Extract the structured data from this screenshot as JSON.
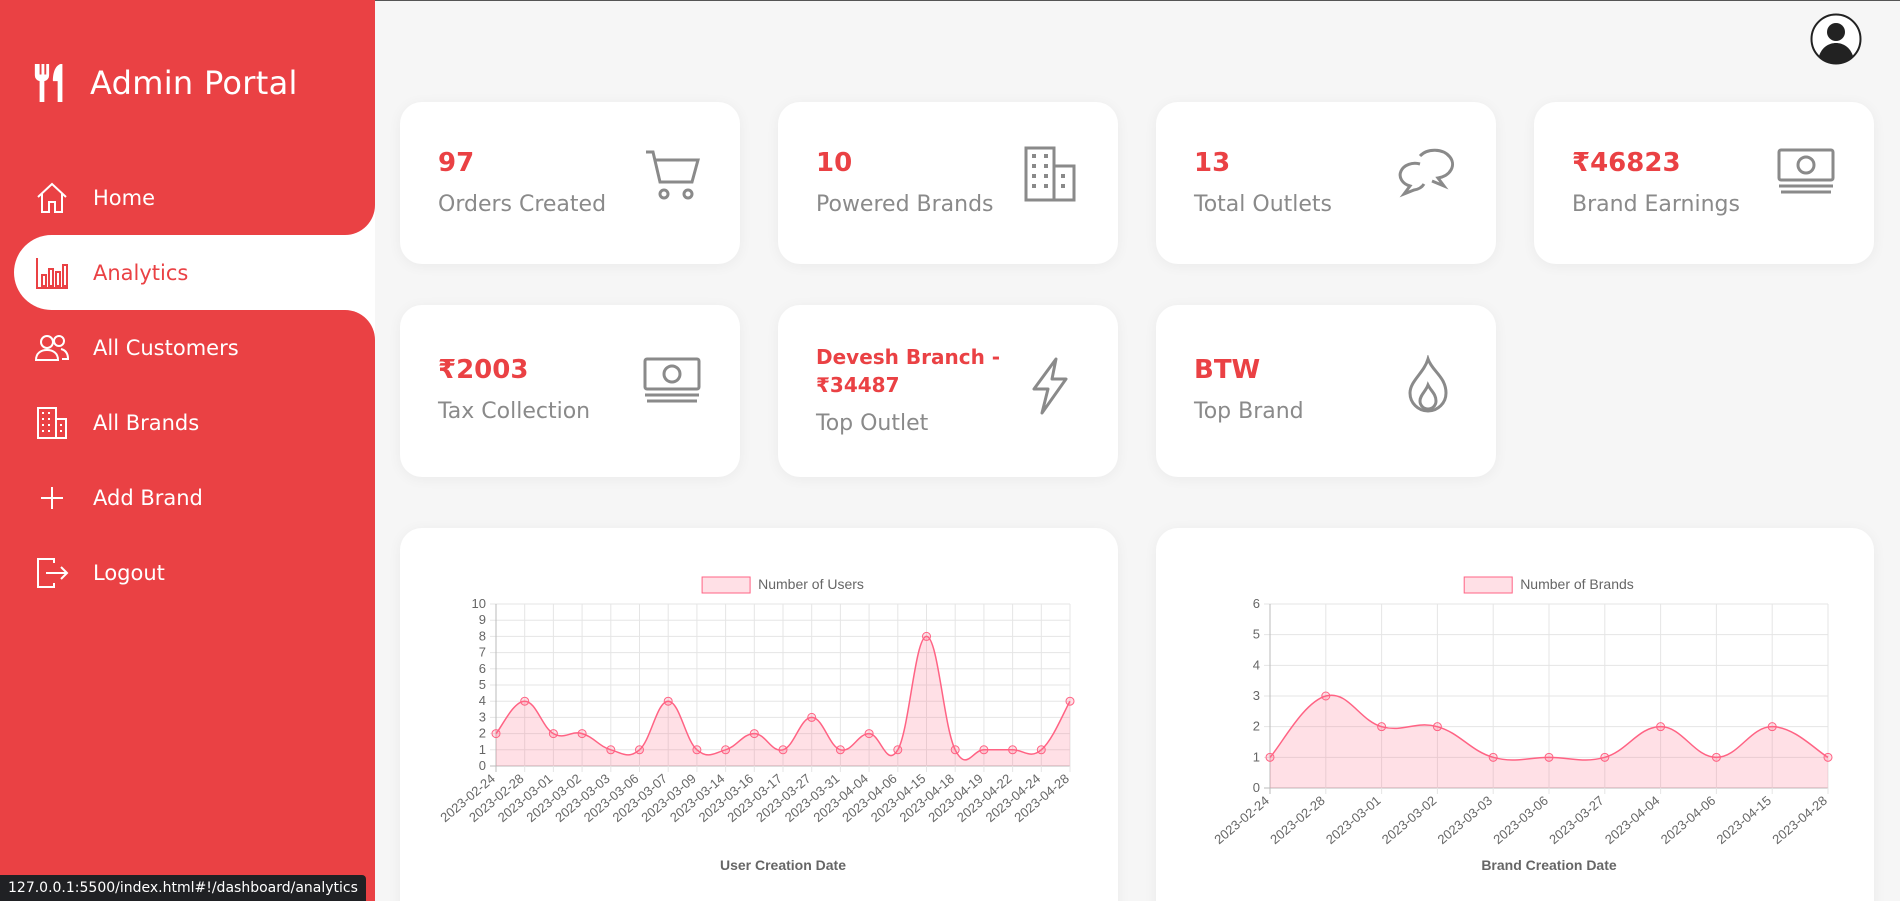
{
  "app": {
    "title": "Admin Portal"
  },
  "nav": [
    {
      "label": "Home",
      "icon": "home-icon",
      "active": false
    },
    {
      "label": "Analytics",
      "icon": "bar-chart-icon",
      "active": true
    },
    {
      "label": "All Customers",
      "icon": "users-icon",
      "active": false
    },
    {
      "label": "All Brands",
      "icon": "building-icon",
      "active": false
    },
    {
      "label": "Add Brand",
      "icon": "plus-icon",
      "active": false
    },
    {
      "label": "Logout",
      "icon": "logout-icon",
      "active": false
    }
  ],
  "status_url": "127.0.0.1:5500/index.html#!/dashboard/analytics",
  "stats": [
    {
      "value": "97",
      "label": "Orders Created",
      "icon": "cart-icon"
    },
    {
      "value": "10",
      "label": "Powered Brands",
      "icon": "building-icon"
    },
    {
      "value": "13",
      "label": "Total Outlets",
      "icon": "chat-bubbles-icon"
    },
    {
      "value": "₹46823",
      "label": "Brand Earnings",
      "icon": "cash-icon"
    },
    {
      "value": "₹2003",
      "label": "Tax Collection",
      "icon": "cash-icon"
    },
    {
      "value_line1": "Devesh Branch -",
      "value_line2": "₹34487",
      "label": "Top Outlet",
      "icon": "lightning-icon"
    },
    {
      "value": "BTW",
      "label": "Top Brand",
      "icon": "flame-icon"
    }
  ],
  "colors": {
    "accent": "#ea4144",
    "line": "#ff6384",
    "fill": "rgba(255,99,132,0.2)"
  },
  "chart_data": [
    {
      "type": "area",
      "legend": "Number of Users",
      "xlabel": "User Creation Date",
      "ylim": [
        0,
        10
      ],
      "categories": [
        "2023-02-24",
        "2023-02-28",
        "2023-03-01",
        "2023-03-02",
        "2023-03-03",
        "2023-03-06",
        "2023-03-07",
        "2023-03-09",
        "2023-03-14",
        "2023-03-16",
        "2023-03-17",
        "2023-03-27",
        "2023-03-31",
        "2023-04-04",
        "2023-04-06",
        "2023-04-15",
        "2023-04-18",
        "2023-04-19",
        "2023-04-22",
        "2023-04-24",
        "2023-04-28"
      ],
      "values": [
        2,
        4,
        2,
        2,
        1,
        1,
        4,
        1,
        1,
        2,
        1,
        3,
        1,
        2,
        1,
        8,
        1,
        1,
        1,
        1,
        4
      ]
    },
    {
      "type": "area",
      "legend": "Number of Brands",
      "xlabel": "Brand Creation Date",
      "ylim": [
        0,
        6
      ],
      "categories": [
        "2023-02-24",
        "2023-02-28",
        "2023-03-01",
        "2023-03-02",
        "2023-03-03",
        "2023-03-06",
        "2023-03-27",
        "2023-04-04",
        "2023-04-06",
        "2023-04-15",
        "2023-04-28"
      ],
      "values": [
        1,
        3,
        2,
        2,
        1,
        1,
        1,
        2,
        1,
        2,
        1
      ]
    }
  ]
}
